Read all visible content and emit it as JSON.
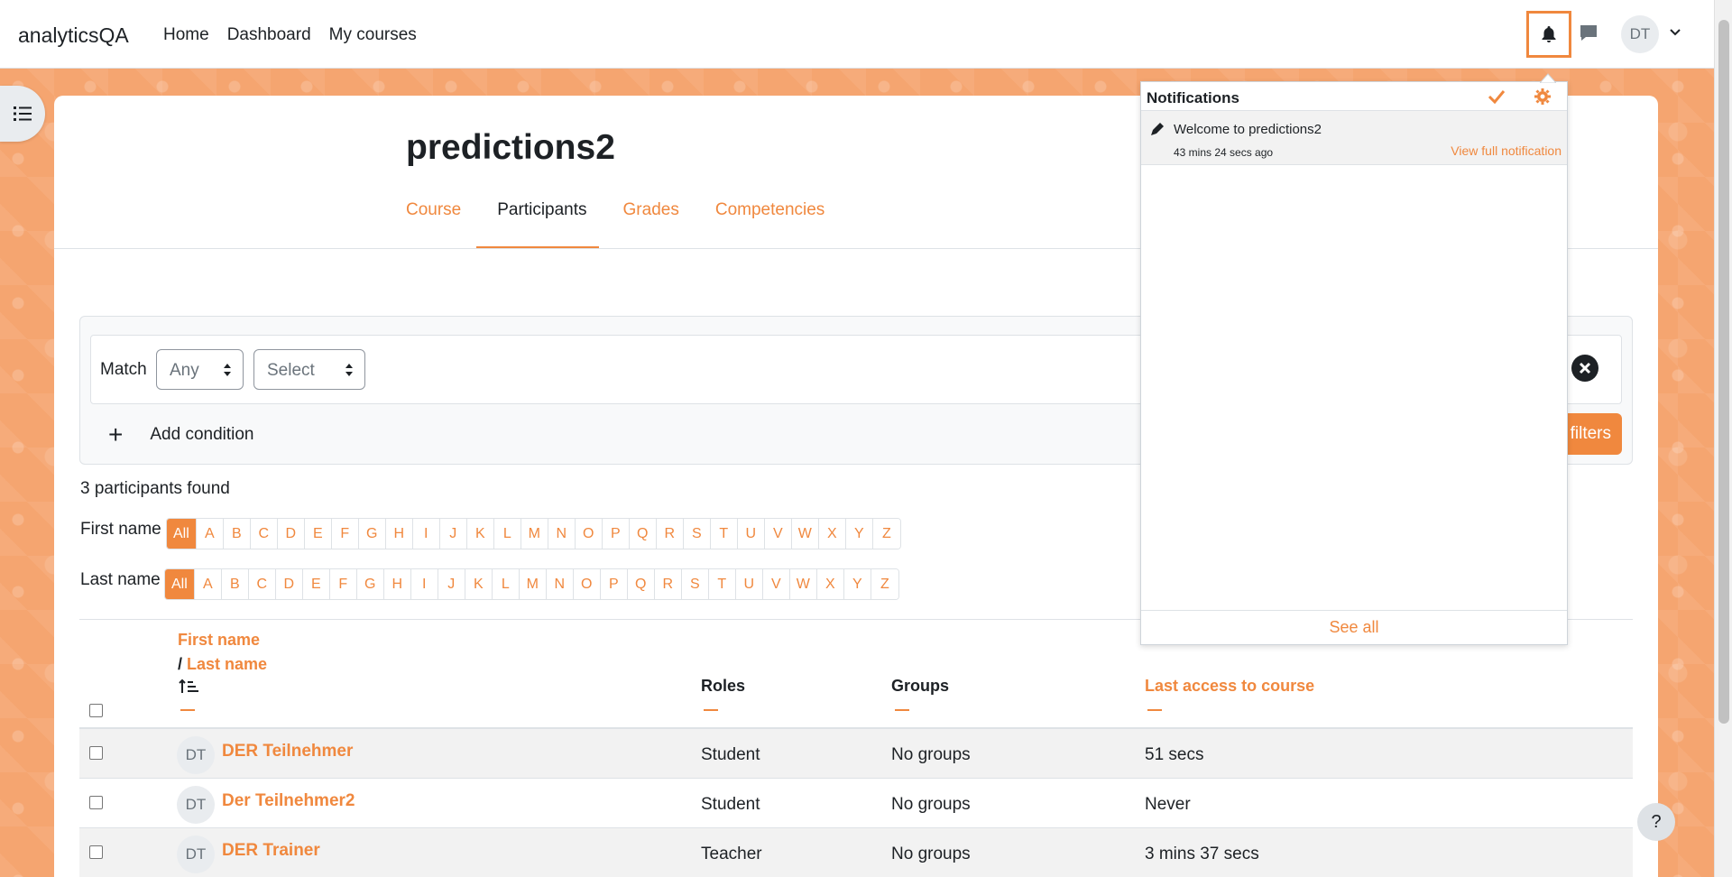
{
  "navbar": {
    "brand": "analyticsQA",
    "links": [
      "Home",
      "Dashboard",
      "My courses"
    ],
    "avatar_initials": "DT",
    "icons": {
      "notifications": "bell-icon",
      "messages": "chat-icon",
      "user_menu": "chevron-down-icon"
    }
  },
  "course": {
    "title": "predictions2",
    "tabs": [
      {
        "label": "Course",
        "active": false
      },
      {
        "label": "Participants",
        "active": true
      },
      {
        "label": "Grades",
        "active": false
      },
      {
        "label": "Competencies",
        "active": false
      }
    ]
  },
  "filter": {
    "match_label": "Match",
    "match_value": "Any",
    "condition_value": "Select",
    "add_condition": "Add condition",
    "apply_label": "filters"
  },
  "participants": {
    "found_text": "3 participants found",
    "first_name_label": "First name",
    "last_name_label": "Last name",
    "initials": [
      "All",
      "A",
      "B",
      "C",
      "D",
      "E",
      "F",
      "G",
      "H",
      "I",
      "J",
      "K",
      "L",
      "M",
      "N",
      "O",
      "P",
      "Q",
      "R",
      "S",
      "T",
      "U",
      "V",
      "W",
      "X",
      "Y",
      "Z"
    ],
    "columns": {
      "first_name": "First name",
      "slash": "/",
      "last_name": "Last name",
      "roles": "Roles",
      "groups": "Groups",
      "last_access": "Last access to course"
    },
    "rows": [
      {
        "initials": "DT",
        "name": "DER Teilnehmer",
        "role": "Student",
        "groups": "No groups",
        "last_access": "51 secs"
      },
      {
        "initials": "DT",
        "name": "Der Teilnehmer2",
        "role": "Student",
        "groups": "No groups",
        "last_access": "Never"
      },
      {
        "initials": "DT",
        "name": "DER Trainer",
        "role": "Teacher",
        "groups": "No groups",
        "last_access": "3 mins 37 secs"
      }
    ]
  },
  "notifications": {
    "title": "Notifications",
    "items": [
      {
        "text": "Welcome to predictions2",
        "time": "43 mins 24 secs ago",
        "link": "View full notification"
      }
    ],
    "see_all": "See all"
  },
  "help": {
    "label": "?"
  },
  "colors": {
    "accent": "#f0883e",
    "text": "#1d2125"
  }
}
